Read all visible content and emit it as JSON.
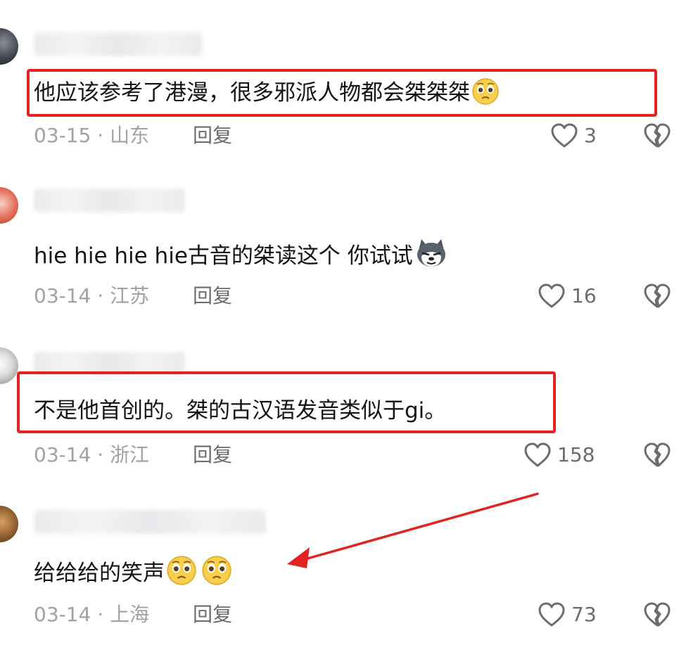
{
  "colors": {
    "highlight_box": "#e32222",
    "arrow": "#e32222",
    "meta_text": "#a1a1a6",
    "action_text": "#6b6b70"
  },
  "comments": [
    {
      "text": "他应该参考了港漫，很多邪派人物都会桀桀桀",
      "emojis": [
        "pleading-face-emoji"
      ],
      "date": "03-15",
      "location": "山东",
      "reply_label": "回复",
      "likes": "3",
      "highlighted": true
    },
    {
      "text": "hie hie hie hie古音的桀读这个 你试试",
      "emojis": [
        "husky-dog-emoji"
      ],
      "date": "03-14",
      "location": "江苏",
      "reply_label": "回复",
      "likes": "16",
      "highlighted": false
    },
    {
      "text": "不是他首创的。桀的古汉语发音类似于gi。",
      "emojis": [],
      "date": "03-14",
      "location": "浙江",
      "reply_label": "回复",
      "likes": "158",
      "highlighted": true
    },
    {
      "text": "给给给的笑声",
      "emojis": [
        "pleading-face-emoji",
        "pleading-face-emoji"
      ],
      "date": "03-14",
      "location": "上海",
      "reply_label": "回复",
      "likes": "73",
      "highlighted": false,
      "arrow_pointing": true
    }
  ],
  "meta_separator": "·"
}
